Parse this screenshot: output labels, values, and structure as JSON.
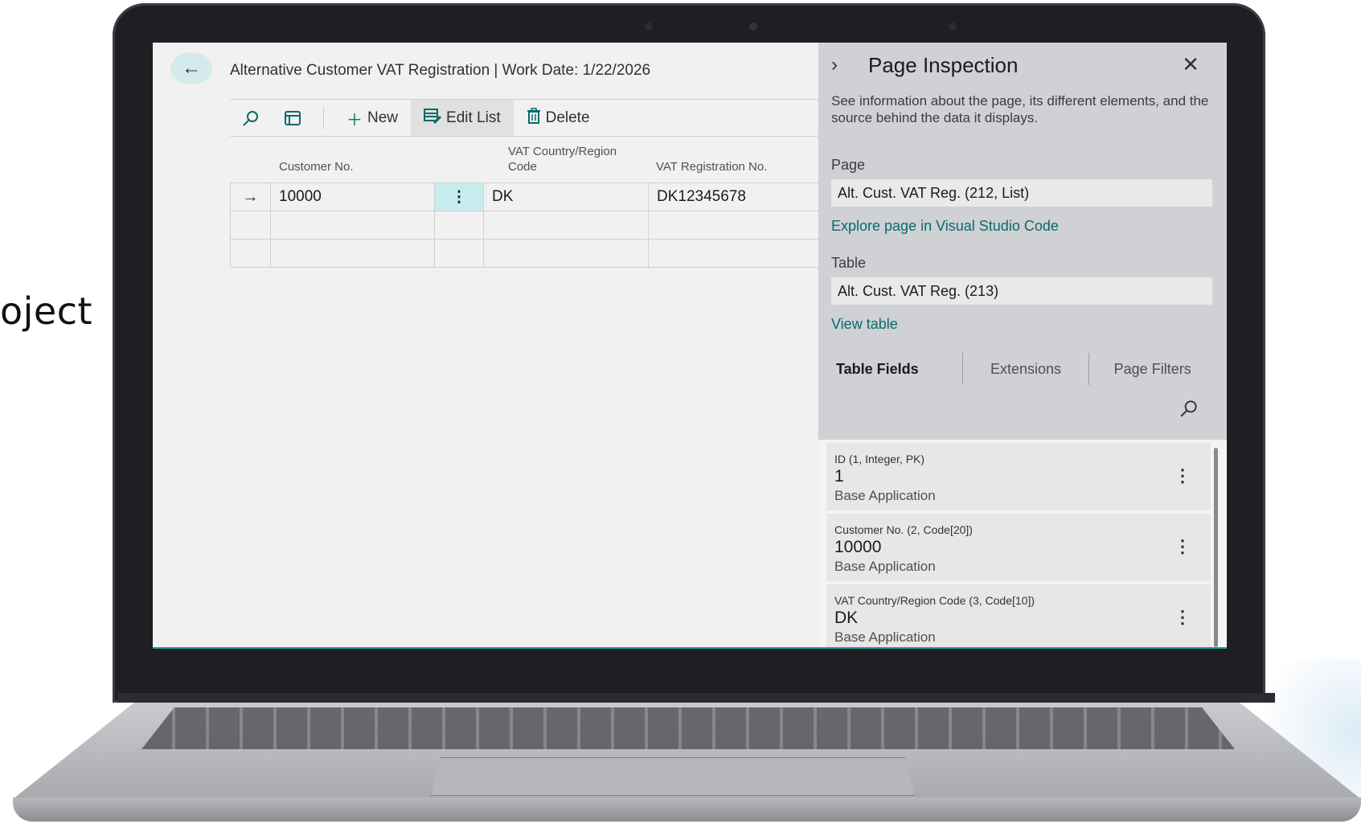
{
  "side_text": "oject",
  "screen": {
    "title": "Alternative Customer VAT Registration | Work Date: 1/22/2026",
    "toolbar": {
      "new_label": "New",
      "edit_list_label": "Edit List",
      "delete_label": "Delete"
    },
    "grid": {
      "columns": [
        "Customer No.",
        "VAT Country/Region Code",
        "VAT Registration No."
      ],
      "column_header_lines": {
        "col2_line1": "VAT Country/Region",
        "col2_line2": "Code"
      },
      "rows": [
        {
          "customer_no": "10000",
          "vat_country": "DK",
          "vat_reg_no": "DK12345678"
        },
        {
          "customer_no": "",
          "vat_country": "",
          "vat_reg_no": ""
        },
        {
          "customer_no": "",
          "vat_country": "",
          "vat_reg_no": ""
        }
      ]
    }
  },
  "inspection": {
    "title": "Page Inspection",
    "description": "See information about the page, its different elements, and the source behind the data it displays.",
    "page_label": "Page",
    "page_value": "Alt. Cust. VAT Reg. (212, List)",
    "explore_link": "Explore page in Visual Studio Code",
    "table_label": "Table",
    "table_value": "Alt. Cust. VAT Reg. (213)",
    "view_table_link": "View table",
    "tabs": [
      "Table Fields",
      "Extensions",
      "Page Filters"
    ],
    "fields": [
      {
        "title": "ID (1, Integer, PK)",
        "value": "1",
        "source": "Base Application"
      },
      {
        "title": "Customer No. (2, Code[20])",
        "value": "10000",
        "source": "Base Application"
      },
      {
        "title": "VAT Country/Region Code (3, Code[10])",
        "value": "DK",
        "source": "Base Application"
      }
    ]
  },
  "colors": {
    "accent": "#0b6a6a",
    "selection": "#c6ecee",
    "pane_bg": "#cfd1d4"
  },
  "icons": [
    "back-arrow-icon",
    "search-icon",
    "filter-pane-icon",
    "plus-icon",
    "edit-list-icon",
    "trash-icon",
    "row-arrow-icon",
    "more-vertical-icon",
    "chevron-right-icon",
    "close-icon"
  ]
}
